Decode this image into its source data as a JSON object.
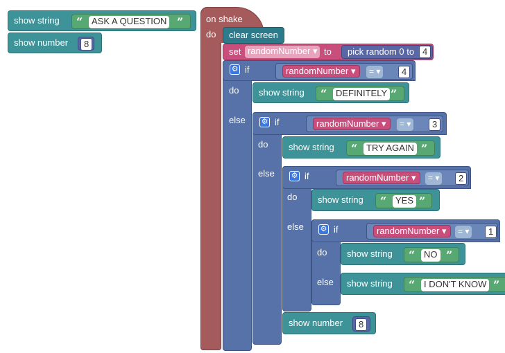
{
  "standalone": {
    "show_string_label": "show string",
    "show_string_value": "ASK A QUESTION",
    "show_number_label": "show number",
    "show_number_value": "8"
  },
  "event": {
    "label": "on shake",
    "do_label": "do"
  },
  "clear_screen": "clear screen",
  "set_block": {
    "set_label": "set",
    "variable": "randomNumber",
    "to_label": "to",
    "pick_label": "pick random 0 to",
    "max": "4"
  },
  "if1": {
    "if_label": "if",
    "variable": "randomNumber",
    "op": "=",
    "value": "4",
    "do_label": "do",
    "else_label": "else",
    "show_label": "show string",
    "text": "DEFINITELY"
  },
  "if2": {
    "if_label": "if",
    "variable": "randomNumber",
    "op": "=",
    "value": "3",
    "do_label": "do",
    "else_label": "else",
    "show_label": "show string",
    "text": "TRY AGAIN"
  },
  "if3": {
    "if_label": "if",
    "variable": "randomNumber",
    "op": "=",
    "value": "2",
    "do_label": "do",
    "else_label": "else",
    "show_label": "show string",
    "text": "YES",
    "show_number_label": "show number",
    "show_number_value": "8"
  },
  "if4": {
    "if_label": "if",
    "variable": "randomNumber",
    "op": "=",
    "value": "1",
    "do_label": "do",
    "else_label": "else",
    "do_show_label": "show string",
    "do_text": "NO",
    "else_show_label": "show string",
    "else_text": "I DON'T KNOW"
  },
  "symbols": {
    "open_quote": "“",
    "close_quote": "”",
    "dropdown": "▾",
    "gear": "⚙"
  },
  "colors": {
    "event": "#a55b5b",
    "basic": "#2d7b8a",
    "logic": "#5672a8",
    "math": "#5a67a6",
    "variables": "#c94e7c",
    "text": "#58a874"
  }
}
